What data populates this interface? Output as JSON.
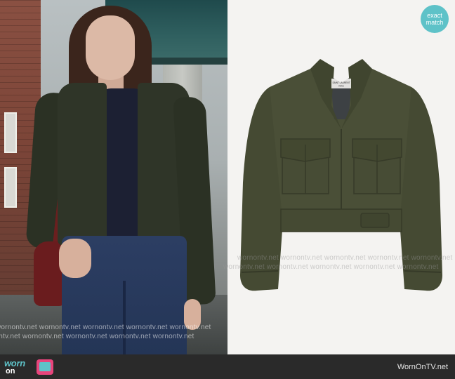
{
  "badge": {
    "line1": "exact",
    "line2": "match",
    "color": "#5ec2c8"
  },
  "watermark_text": "wornontv.net",
  "footer": {
    "logo_line1": "worn",
    "logo_line2": "on",
    "logo_icon": "tv-icon",
    "site_url": "WornOnTV.net",
    "accent_color": "#5ec2c8",
    "pink_color": "#e8457c"
  },
  "product": {
    "label_line1": "SAINT LAURENT",
    "label_line2": "PARIS",
    "fabric_color": "#474c35"
  }
}
